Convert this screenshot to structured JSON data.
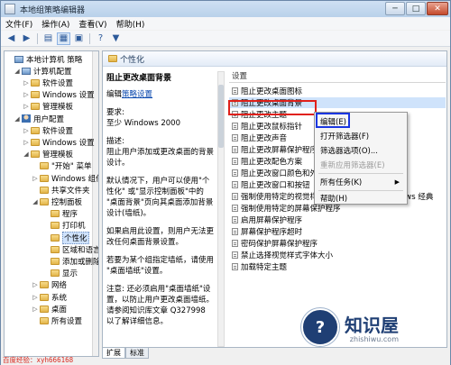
{
  "window": {
    "title": "本地组策略编辑器",
    "controls": {
      "minimize": "─",
      "maximize": "□",
      "close": "✕"
    }
  },
  "menu": [
    "文件(F)",
    "操作(A)",
    "查看(V)",
    "帮助(H)"
  ],
  "toolbar": {
    "icons": [
      "back-icon",
      "forward-icon",
      "folder-up-icon",
      "show-tree-icon",
      "properties-icon",
      "help-icon",
      "filter-icon"
    ],
    "glyphs": [
      "◀",
      "▶",
      "▤",
      "▦",
      "▣",
      "?",
      "▼"
    ]
  },
  "tree": {
    "items": [
      {
        "label": "本地计算机 策略",
        "toggle": "",
        "icon": "pc",
        "indent": 0
      },
      {
        "label": "计算机配置",
        "toggle": "◢",
        "icon": "pc",
        "indent": 1
      },
      {
        "label": "软件设置",
        "toggle": "▷",
        "icon": "folder",
        "indent": 2
      },
      {
        "label": "Windows 设置",
        "toggle": "▷",
        "icon": "folder",
        "indent": 2
      },
      {
        "label": "管理模板",
        "toggle": "▷",
        "icon": "folder",
        "indent": 2
      },
      {
        "label": "用户配置",
        "toggle": "◢",
        "icon": "user",
        "indent": 1
      },
      {
        "label": "软件设置",
        "toggle": "▷",
        "icon": "folder",
        "indent": 2
      },
      {
        "label": "Windows 设置",
        "toggle": "▷",
        "icon": "folder",
        "indent": 2
      },
      {
        "label": "管理模板",
        "toggle": "◢",
        "icon": "folder",
        "indent": 2
      },
      {
        "label": "\"开始\" 菜单",
        "toggle": "",
        "icon": "folder",
        "indent": 3
      },
      {
        "label": "Windows 组件",
        "toggle": "▷",
        "icon": "folder",
        "indent": 3
      },
      {
        "label": "共享文件夹",
        "toggle": "",
        "icon": "folder",
        "indent": 3
      },
      {
        "label": "控制面板",
        "toggle": "◢",
        "icon": "folder",
        "indent": 3
      },
      {
        "label": "程序",
        "toggle": "",
        "icon": "folder",
        "indent": 4
      },
      {
        "label": "打印机",
        "toggle": "",
        "icon": "folder",
        "indent": 4
      },
      {
        "label": "个性化",
        "toggle": "",
        "icon": "folder",
        "indent": 4,
        "selected": true
      },
      {
        "label": "区域和语言",
        "toggle": "",
        "icon": "folder",
        "indent": 4
      },
      {
        "label": "添加或删除",
        "toggle": "",
        "icon": "folder",
        "indent": 4
      },
      {
        "label": "显示",
        "toggle": "",
        "icon": "folder",
        "indent": 4
      },
      {
        "label": "网络",
        "toggle": "▷",
        "icon": "folder",
        "indent": 3
      },
      {
        "label": "系统",
        "toggle": "▷",
        "icon": "folder",
        "indent": 3
      },
      {
        "label": "桌面",
        "toggle": "▷",
        "icon": "folder",
        "indent": 3
      },
      {
        "label": "所有设置",
        "toggle": "",
        "icon": "folder",
        "indent": 3
      }
    ]
  },
  "section": {
    "title": "个性化"
  },
  "description": {
    "title": "阻止更改桌面背景",
    "edit_prefix": "编辑",
    "edit_link": "策略设置",
    "requirement_label": "要求:",
    "requirement_value": "至少 Windows 2000",
    "desc_label": "描述:",
    "desc_text": "阻止用户添加或更改桌面的背景设计。",
    "para1": "默认情况下，用户可以使用\"个性化\" 或\"显示控制面板\"中的 \"桌面背景\"页向其桌面添加背景设计(墙纸)。",
    "para2": "如果启用此设置，则用户无法更改任何桌面背景设置。",
    "para3": "若要为某个组指定墙纸，请使用 \"桌面墙纸\"设置。",
    "para4": "注意: 还必须启用\"桌面墙纸\"设置，以防止用户更改桌面墙纸。请参阅知识库文章 Q327998 以了解详细信息。"
  },
  "list": {
    "header": "设置",
    "rows": [
      "阻止更改桌面图标",
      "阻止更改桌面背景",
      "阻止更改主题",
      "阻止更改鼠标指针",
      "阻止更改声音",
      "阻止更改屏幕保护程序",
      "阻止更改配色方案",
      "阻止更改窗口颜色和外观",
      "阻止更改窗口和按钮",
      "强制使用特定的视觉样式文件或强制使用 Windows 经典",
      "强制使用特定的屏幕保护程序",
      "启用屏幕保护程序",
      "屏幕保护程序超时",
      "密码保护屏幕保护程序",
      "禁止选择视觉样式字体大小",
      "加载特定主题"
    ],
    "highlight_index": 1
  },
  "context_menu": {
    "items": [
      "编辑(E)",
      "打开筛选器(F)",
      "筛选器选项(O)...",
      "重新应用筛选器(E)",
      "所有任务(K)",
      "帮助(H)"
    ],
    "disabled_index": 3,
    "submenu_index": 4,
    "submenu_arrow": "▶"
  },
  "tabs": [
    "扩展",
    "标准"
  ],
  "watermark": {
    "red_text": "百度经验：xyh666168"
  },
  "brand": {
    "name": "知识屋",
    "site": "zhishiwu.com",
    "logo_glyph": "?"
  },
  "colors": {
    "highlight_red": "#e0201a",
    "highlight_blue": "#1a36e0",
    "selection": "#cfe3fb"
  }
}
